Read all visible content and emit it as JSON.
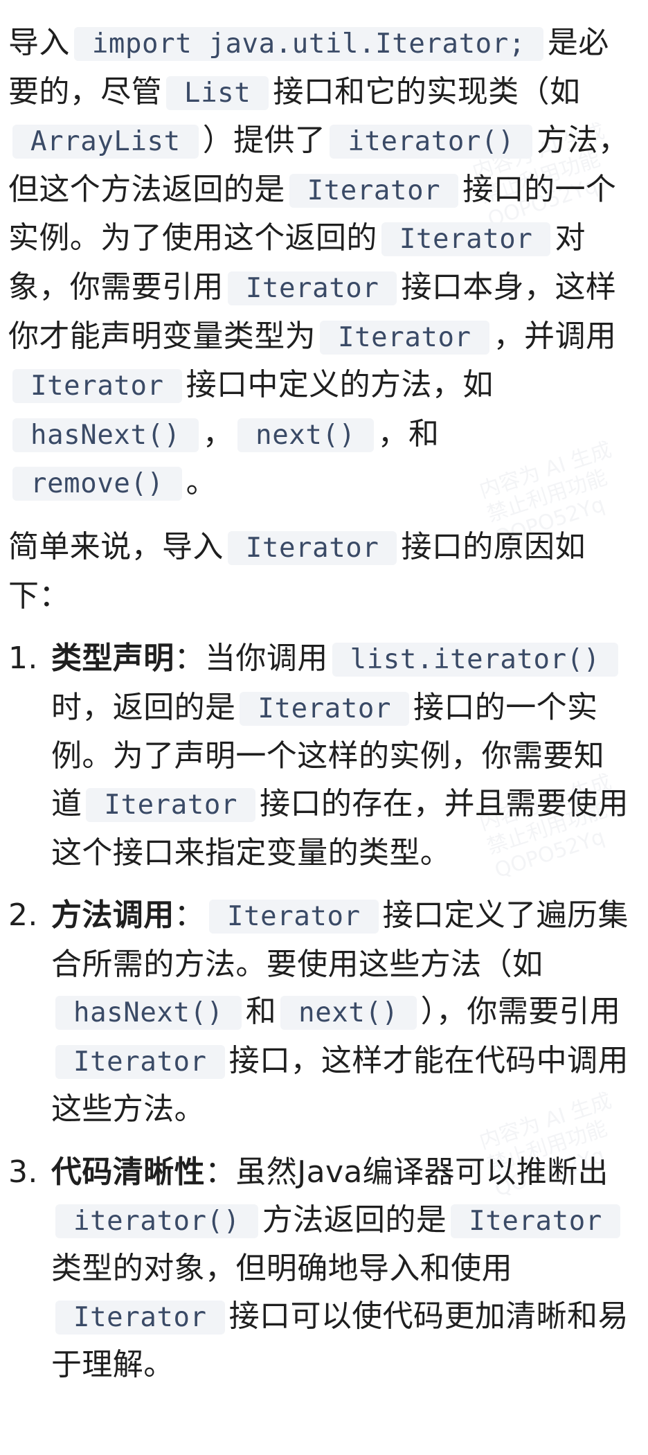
{
  "intro": {
    "t1": "导入",
    "code_import": "import java.util.Iterator;",
    "t2": "是必要的，尽管",
    "code_list": "List",
    "t3": "接口和它的实现类（如",
    "code_arraylist": "ArrayList",
    "t4": "）提供了",
    "code_iterator_method": "iterator()",
    "t5": "方法，但这个方法返回的是",
    "code_iterator_1": "Iterator",
    "t6": "接口的一个实例。为了使用这个返回的",
    "code_iterator_2": "Iterator",
    "t7": "对象，你需要引用",
    "code_iterator_3": "Iterator",
    "t8": "接口本身，这样你才能声明变量类型为",
    "code_iterator_4": "Iterator",
    "t9": "，并调用",
    "code_iterator_5": "Iterator",
    "t10": "接口中定义的方法，如",
    "code_hasnext": "hasNext()",
    "t11": "，",
    "code_next": "next()",
    "t12": "，和",
    "code_remove": "remove()",
    "t13": "。"
  },
  "summary": {
    "t1": "简单来说，导入",
    "code_iterator": "Iterator",
    "t2": "接口的原因如下："
  },
  "items": [
    {
      "number": "1.",
      "title": "类型声明",
      "colon": "：",
      "t1": "当你调用",
      "code1": "list.iterator()",
      "t2": "时，返回的是",
      "code2": "Iterator",
      "t3": "接口的一个实例。为了声明一个这样的实例，你需要知道",
      "code3": "Iterator",
      "t4": "接口的存在，并且需要使用这个接口来指定变量的类型。"
    },
    {
      "number": "2.",
      "title": "方法调用",
      "colon": "：",
      "code1": "Iterator",
      "t1": "接口定义了遍历集合所需的方法。要使用这些方法（如",
      "code2": "hasNext()",
      "t2": "和",
      "code3": "next()",
      "t3": "），你需要引用",
      "code4": "Iterator",
      "t4": "接口，这样才能在代码中调用这些方法。"
    },
    {
      "number": "3.",
      "title": "代码清晰性",
      "colon": "：",
      "t1": "虽然Java编译器可以推断出",
      "code1": "iterator()",
      "t2": "方法返回的是",
      "code2": "Iterator",
      "t3": "类型的对象，但明确地导入和使用",
      "code3": "Iterator",
      "t4": "接口可以使代码更加清晰和易于理解。"
    }
  ],
  "watermark": {
    "line1": "内容为 AI 生成",
    "line2": "禁止利用功能",
    "line3": "QOPO52Yq"
  }
}
